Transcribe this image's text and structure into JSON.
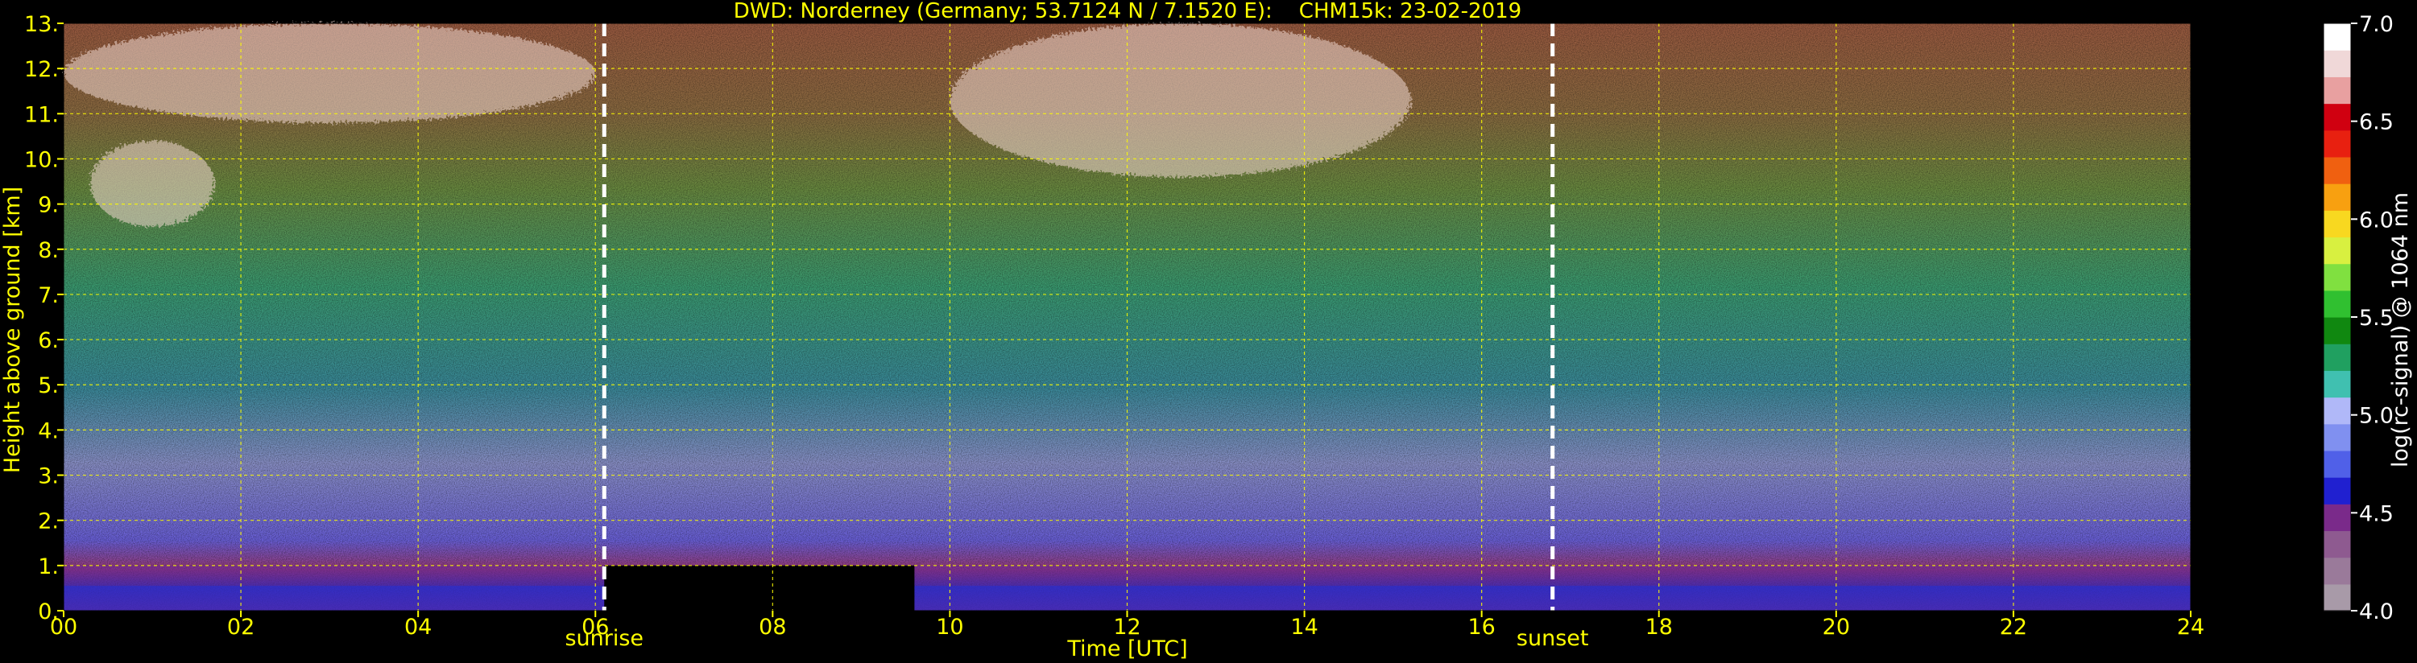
{
  "chart_data": {
    "type": "heatmap",
    "title": "DWD: Norderney (Germany; 53.7124 N / 7.1520 E):    CHM15k: 23-02-2019",
    "xlabel": "Time [UTC]",
    "ylabel": "Height above ground [km]",
    "x_range": [
      0,
      24
    ],
    "y_range": [
      0,
      13
    ],
    "x_tick_labels": [
      "00",
      "02",
      "04",
      "06",
      "08",
      "10",
      "12",
      "14",
      "16",
      "18",
      "20",
      "22",
      "24"
    ],
    "x_tick_values": [
      0,
      2,
      4,
      6,
      8,
      10,
      12,
      14,
      16,
      18,
      20,
      22,
      24
    ],
    "y_tick_labels": [
      "0.",
      "1.",
      "2.",
      "3.",
      "4.",
      "5.",
      "6.",
      "7.",
      "8.",
      "9.",
      "10.",
      "11.",
      "12.",
      "13."
    ],
    "y_tick_values": [
      0,
      1,
      2,
      3,
      4,
      5,
      6,
      7,
      8,
      9,
      10,
      11,
      12,
      13
    ],
    "grid": true,
    "events": [
      {
        "label": "sunrise",
        "time": 6.1
      },
      {
        "label": "sunset",
        "time": 16.8
      }
    ],
    "colorbar": {
      "label": "log(rc-signal) @ 1064 nm",
      "range": [
        4.0,
        7.0
      ],
      "tick_labels": [
        "4.0",
        "4.5",
        "5.0",
        "5.5",
        "6.0",
        "6.5",
        "7.0"
      ],
      "tick_values": [
        4.0,
        4.5,
        5.0,
        5.5,
        6.0,
        6.5,
        7.0
      ],
      "colors": [
        "#a89aa8",
        "#9a7a9a",
        "#8e5a90",
        "#7a2a8a",
        "#2020d0",
        "#5060e8",
        "#8090f0",
        "#b0b8f8",
        "#40c0b0",
        "#20a060",
        "#108810",
        "#30c030",
        "#80e040",
        "#d8f040",
        "#f8d820",
        "#f8a010",
        "#f06010",
        "#e82010",
        "#d00010",
        "#e8a0a0",
        "#f0d8d8",
        "#ffffff"
      ]
    },
    "data_gaps": [
      {
        "start": 6.1,
        "end": 9.6,
        "height_max": 1.0,
        "description": "no signal (black) below 1 km"
      }
    ],
    "features": [
      {
        "type": "cloud",
        "start": 0,
        "end": 6.0,
        "height_min": 10.8,
        "height_max": 13.0
      },
      {
        "type": "cloud",
        "start": 0.3,
        "end": 1.7,
        "height_min": 8.5,
        "height_max": 10.4
      },
      {
        "type": "cloud",
        "start": 10.0,
        "end": 15.2,
        "height_min": 9.6,
        "height_max": 13.0
      },
      {
        "type": "boundary_layer",
        "start": 0,
        "end": 24,
        "height_min": 0,
        "height_max": 1.0
      }
    ]
  },
  "colors": {
    "text_accent": "#ffff00",
    "grid": "#ffff00",
    "background": "#000000"
  }
}
